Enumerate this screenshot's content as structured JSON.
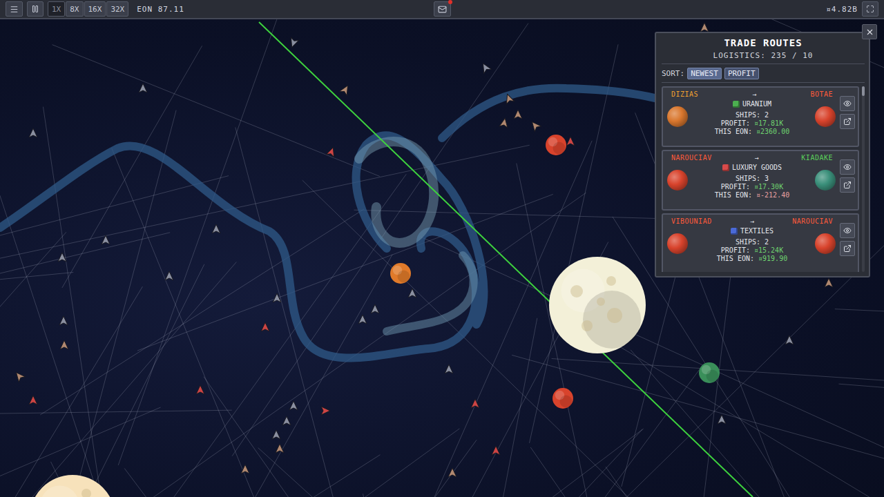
{
  "toolbar": {
    "speeds": [
      {
        "label": "1X",
        "selected": true
      },
      {
        "label": "8X",
        "selected": false
      },
      {
        "label": "16X",
        "selected": false
      },
      {
        "label": "32X",
        "selected": false
      }
    ],
    "eon": "EON 87.11",
    "mail_unread": true,
    "money": "¤4.82B"
  },
  "panel": {
    "title": "TRADE ROUTES",
    "logistics": "LOGISTICS: 235 / 10",
    "sort_label": "SORT:",
    "sort_options": [
      {
        "label": "NEWEST",
        "selected": true
      },
      {
        "label": "PROFIT",
        "selected": false
      }
    ],
    "routes": [
      {
        "from": "DIZIAS",
        "from_color": "#f0a030",
        "from_planet": "#d9772e",
        "arrow": "→",
        "to": "BOTAE",
        "to_color": "#ff5a3a",
        "to_planet": "#d8432c",
        "commodity": "URANIUM",
        "commodity_color": "#4caf50",
        "ships": "SHIPS: 2",
        "profit_label": "PROFIT:",
        "profit": "¤17.81K",
        "eon_label": "THIS EON:",
        "eon": "¤2360.00",
        "eon_color": "#6fd36f"
      },
      {
        "from": "NAROUCIAV",
        "from_color": "#ff5a3a",
        "from_planet": "#d8432c",
        "arrow": "→",
        "to": "KIADAKE",
        "to_color": "#5ad05a",
        "to_planet": "#3a8f7a",
        "commodity": "LUXURY GOODS",
        "commodity_color": "#d84a4a",
        "ships": "SHIPS: 3",
        "profit_label": "PROFIT:",
        "profit": "¤17.30K",
        "eon_label": "THIS EON:",
        "eon": "¤-212.40",
        "eon_color": "#e8a0a0"
      },
      {
        "from": "VIBOUNIAD",
        "from_color": "#ff5a3a",
        "from_planet": "#d8432c",
        "arrow": "→",
        "to": "NAROUCIAV",
        "to_color": "#ff5a3a",
        "to_planet": "#d8432c",
        "commodity": "TEXTILES",
        "commodity_color": "#4a6ad8",
        "ships": "SHIPS: 2",
        "profit_label": "PROFIT:",
        "profit": "¤15.24K",
        "eon_label": "THIS EON:",
        "eon": "¤919.90",
        "eon_color": "#6fd36f"
      }
    ]
  },
  "map": {
    "planets": [
      {
        "color": "#d8432c"
      },
      {
        "color": "#e07a2a"
      },
      {
        "color": "#f3f0d8"
      },
      {
        "color": "#3a8f5a"
      },
      {
        "color": "#d8432c"
      },
      {
        "color": "#f7e2bb"
      }
    ]
  }
}
